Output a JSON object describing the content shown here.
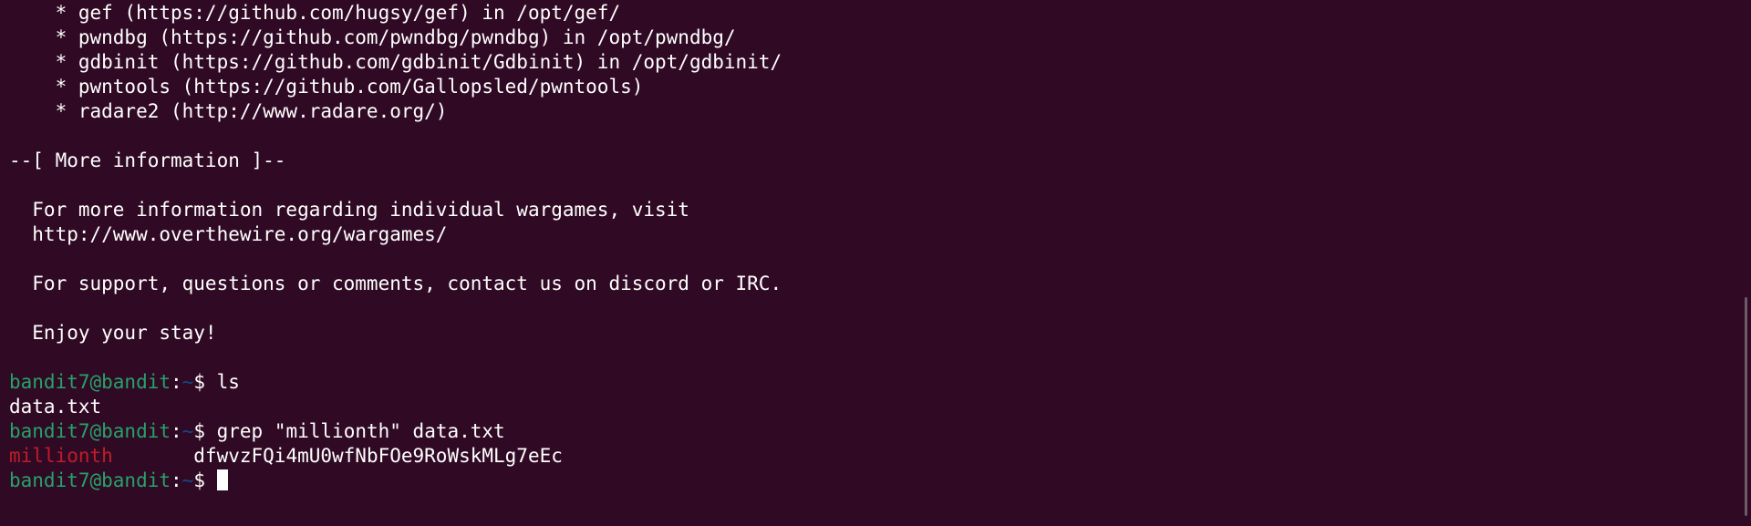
{
  "terminal": {
    "tools": [
      "    * gef (https://github.com/hugsy/gef) in /opt/gef/",
      "    * pwndbg (https://github.com/pwndbg/pwndbg) in /opt/pwndbg/",
      "    * gdbinit (https://github.com/gdbinit/Gdbinit) in /opt/gdbinit/",
      "    * pwntools (https://github.com/Gallopsled/pwntools)",
      "    * radare2 (http://www.radare.org/)"
    ],
    "section_header": "--[ More information ]--",
    "info_line_1": "  For more information regarding individual wargames, visit",
    "info_line_2": "  http://www.overthewire.org/wargames/",
    "support_line": "  For support, questions or comments, contact us on discord or IRC.",
    "enjoy_line": "  Enjoy your stay!",
    "prompt": {
      "user_host": "bandit7@bandit",
      "separator": ":",
      "path": "~",
      "symbol": "$ "
    },
    "commands": [
      {
        "cmd": "ls",
        "output": "data.txt"
      },
      {
        "cmd": "grep \"millionth\" data.txt",
        "match": "millionth",
        "rest": "       dfwvzFQi4mU0wfNbFOe9RoWskMLg7eEc"
      }
    ]
  },
  "colors": {
    "background": "#300a24",
    "user_host": "#26a269",
    "path": "#12488b",
    "match": "#c01c28",
    "text": "#ffffff"
  }
}
